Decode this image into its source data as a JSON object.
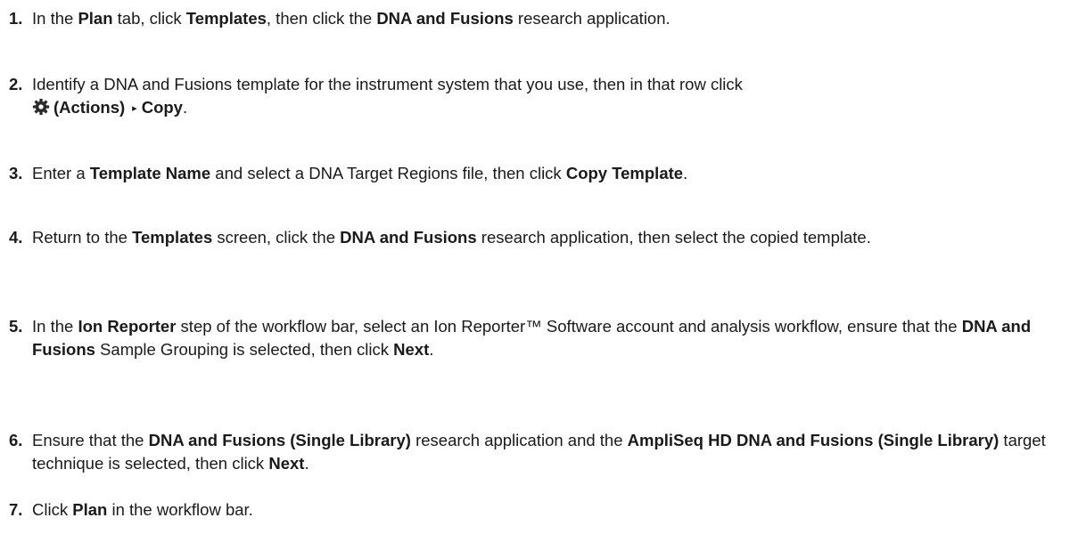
{
  "steps": [
    {
      "number": "1.",
      "parts": [
        "In the ",
        "Plan",
        " tab, click ",
        "Templates",
        ", then click the ",
        "DNA and Fusions",
        " research application."
      ]
    },
    {
      "number": "2.",
      "parts": [
        "Identify a DNA and Fusions template for the instrument system that you use, then in that row click"
      ],
      "line2": {
        "icon": "gear-icon",
        "actions_label": "(Actions)",
        "caret": "▸",
        "copy_label": "Copy",
        "end": "."
      }
    },
    {
      "number": "3.",
      "parts": [
        "Enter a ",
        "Template Name",
        " and select a DNA Target Regions file, then click ",
        "Copy Template",
        "."
      ]
    },
    {
      "number": "4.",
      "parts": [
        "Return to the ",
        "Templates",
        " screen, click the ",
        "DNA and Fusions",
        " research application, then select the copied template."
      ]
    },
    {
      "number": "5.",
      "parts": [
        "In the ",
        "Ion Reporter",
        " step of the workflow bar, select an Ion Reporter™ Software account and analysis workflow, ensure that the ",
        "DNA and Fusions",
        " Sample Grouping is selected, then click ",
        "Next",
        "."
      ]
    },
    {
      "number": "6.",
      "parts": [
        "Ensure that the ",
        "DNA and Fusions (Single Library)",
        " research application and the ",
        "AmpliSeq HD DNA and Fusions (Single Library)",
        " target technique is selected, then click ",
        "Next",
        "."
      ]
    },
    {
      "number": "7.",
      "parts": [
        "Click ",
        "Plan",
        " in the workflow bar."
      ]
    }
  ],
  "colors": {
    "text": "#1a1a1a",
    "icon": "#2b2b2b"
  }
}
